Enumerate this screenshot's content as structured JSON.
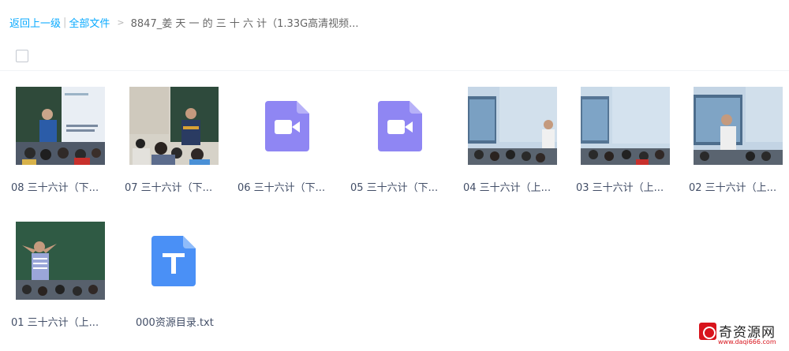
{
  "breadcrumb": {
    "back": "返回上一级",
    "separator": "|",
    "all_files": "全部文件",
    "arrow": ">",
    "current": "8847_姜 天 一 的 三 十 六 计（1.33G高清视频..."
  },
  "files": [
    {
      "label": "08 三十六计（下...",
      "type": "video-thumb"
    },
    {
      "label": "07 三十六计（下...",
      "type": "video-thumb"
    },
    {
      "label": "06 三十六计（下...",
      "type": "video-icon"
    },
    {
      "label": "05 三十六计（下...",
      "type": "video-icon"
    },
    {
      "label": "04 三十六计（上...",
      "type": "video-thumb"
    },
    {
      "label": "03 三十六计（上...",
      "type": "video-thumb"
    },
    {
      "label": "02 三十六计（上...",
      "type": "video-thumb"
    },
    {
      "label": "01 三十六计（上...",
      "type": "video-thumb"
    },
    {
      "label": "000资源目录.txt",
      "type": "txt-icon"
    }
  ],
  "icons": {
    "video_icon": "video-file-icon",
    "txt_icon": "txt-file-icon",
    "checkbox": "select-all-checkbox"
  },
  "colors": {
    "link": "#09aaff",
    "video_icon": "#8f86f3",
    "txt_icon": "#4a90f6"
  },
  "watermark": {
    "text": "奇资源网",
    "url": "www.daqi666.com"
  }
}
